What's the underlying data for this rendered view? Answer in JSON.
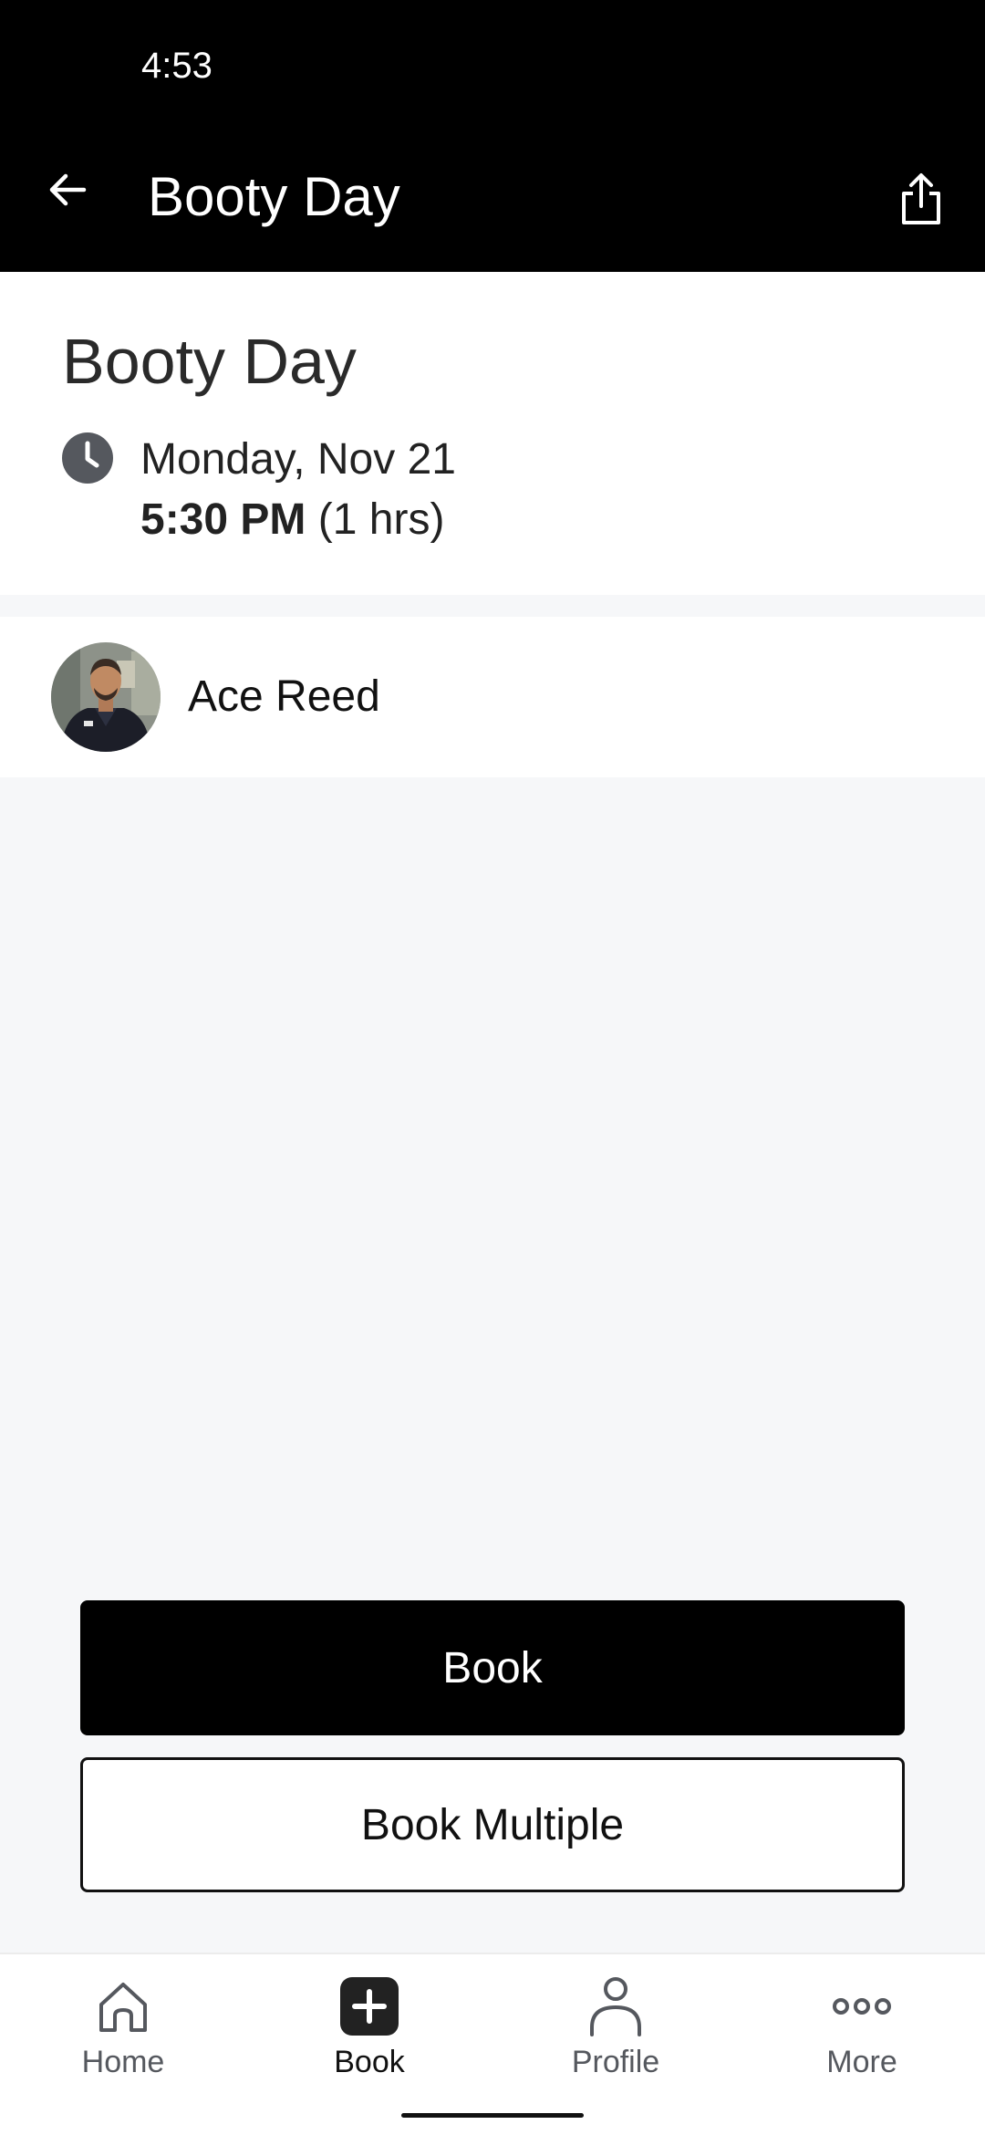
{
  "status_bar": {
    "time": "4:53"
  },
  "app_bar": {
    "title": "Booty Day",
    "back_icon": "arrow-left-icon",
    "share_icon": "share-icon"
  },
  "class_detail": {
    "title": "Booty Day",
    "date": "Monday, Nov 21",
    "time": "5:30 PM",
    "duration": "(1 hrs)",
    "clock_icon": "clock-icon"
  },
  "instructor": {
    "name": "Ace Reed",
    "avatar_icon": "avatar-photo"
  },
  "actions": {
    "book_label": "Book",
    "book_multiple_label": "Book Multiple"
  },
  "bottom_nav": {
    "items": [
      {
        "label": "Home",
        "icon": "home-icon",
        "active": false
      },
      {
        "label": "Book",
        "icon": "plus-square-icon",
        "active": true
      },
      {
        "label": "Profile",
        "icon": "person-icon",
        "active": false
      },
      {
        "label": "More",
        "icon": "more-dots-icon",
        "active": false
      }
    ]
  },
  "colors": {
    "app_bar_bg": "#000000",
    "page_bg": "#f6f7f9",
    "primary_button": "#000000",
    "clock_icon": "#55585e"
  }
}
